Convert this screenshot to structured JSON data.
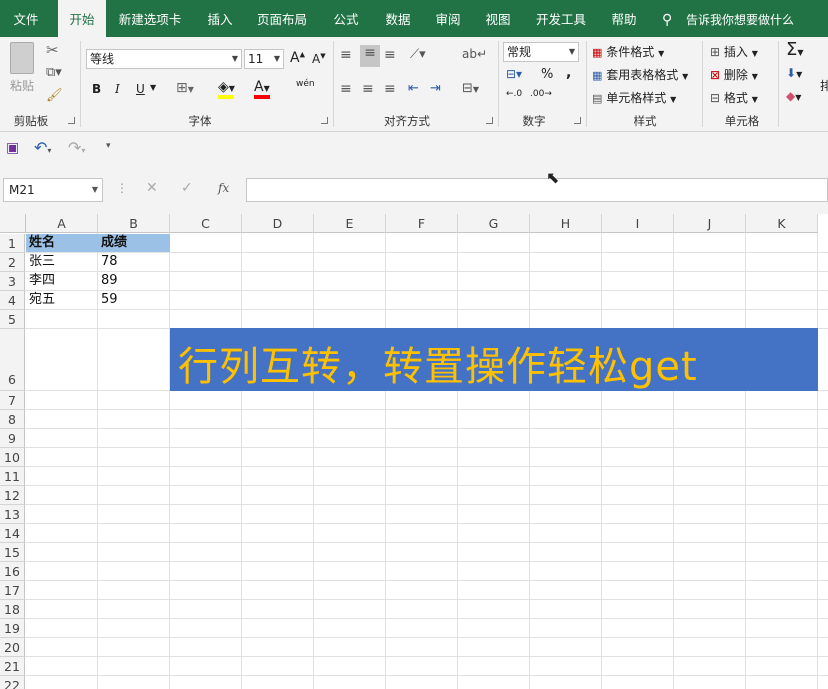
{
  "tabs": [
    "文件",
    "开始",
    "新建选项卡",
    "插入",
    "页面布局",
    "公式",
    "数据",
    "审阅",
    "视图",
    "开发工具",
    "帮助"
  ],
  "tell_me": "告诉我你想要做什么",
  "clipboard": {
    "paste": "粘贴",
    "group": "剪贴板"
  },
  "font": {
    "name": "等线",
    "size": "11",
    "group": "字体",
    "bold": "B",
    "italic": "I",
    "underline": "U",
    "phonetic": "wén"
  },
  "alignment": {
    "group": "对齐方式"
  },
  "number": {
    "format": "常规",
    "group": "数字",
    "percent": "%",
    "comma": ","
  },
  "styles": {
    "conditional": "条件格式",
    "table": "套用表格格式",
    "cell": "单元格样式",
    "group": "样式"
  },
  "cells": {
    "insert": "插入",
    "delete": "删除",
    "format": "格式",
    "group": "单元格"
  },
  "editing": {
    "extra": "排"
  },
  "formula_bar": {
    "name_box": "M21",
    "fx": "fx"
  },
  "columns": [
    "A",
    "B",
    "C",
    "D",
    "E",
    "F",
    "G",
    "H",
    "I",
    "J",
    "K"
  ],
  "rows": [
    "1",
    "2",
    "3",
    "4",
    "5",
    "6",
    "7",
    "8",
    "9",
    "10",
    "11",
    "12",
    "13",
    "14",
    "15",
    "16",
    "17",
    "18",
    "19",
    "20",
    "21",
    "22"
  ],
  "sheet": {
    "headers": [
      "姓名",
      "成绩"
    ],
    "data": [
      [
        "张三",
        "78"
      ],
      [
        "李四",
        "89"
      ],
      [
        "宛五",
        "59"
      ]
    ]
  },
  "banner": "行列互转，转置操作轻松get",
  "colors": {
    "ribbon_green": "#217346",
    "banner_bg": "#4472c4",
    "banner_text": "#ffc000",
    "header_fill": "#9bc2e6"
  }
}
